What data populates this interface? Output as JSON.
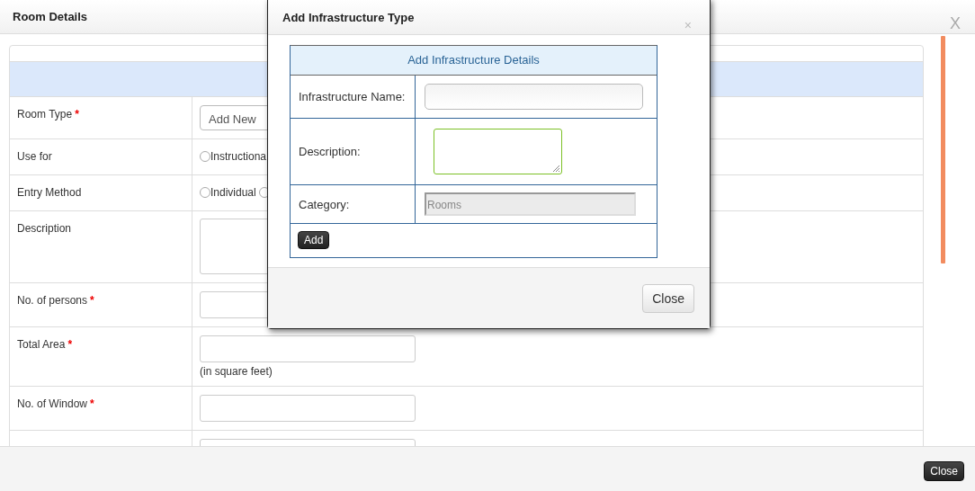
{
  "window": {
    "title": "Room Details",
    "close": "X"
  },
  "form": {
    "rows": [
      {
        "label": "Room Type",
        "required_mark": "*",
        "kind": "select",
        "value": "Add New"
      },
      {
        "label": "Use for",
        "kind": "radio",
        "options": [
          {
            "label": "Instructiona",
            "selected": false
          }
        ]
      },
      {
        "label": "Entry Method",
        "kind": "radio",
        "options": [
          {
            "label": "Individual",
            "selected": false
          },
          {
            "selected": false
          }
        ]
      },
      {
        "label": "Description",
        "kind": "textarea"
      },
      {
        "label": "No. of persons",
        "required_mark": "*",
        "kind": "input"
      },
      {
        "label": "Total Area",
        "required_mark": "*",
        "kind": "input",
        "hint": "(in square feet)"
      },
      {
        "label": "No. of Window",
        "required_mark": "*",
        "kind": "input"
      },
      {
        "kind": "input"
      }
    ]
  },
  "footer": {
    "button": "Close"
  },
  "dialog": {
    "title": "Add Infrastructure Type",
    "close": "×",
    "table_title": "Add Infrastructure Details",
    "fields": [
      {
        "label": "Infrastructure Name:",
        "kind": "input"
      },
      {
        "label": "Description:",
        "kind": "textarea"
      },
      {
        "label": "Category:",
        "kind": "readonly",
        "value": "Rooms"
      }
    ],
    "add_button": "Add",
    "close_button": "Close"
  }
}
